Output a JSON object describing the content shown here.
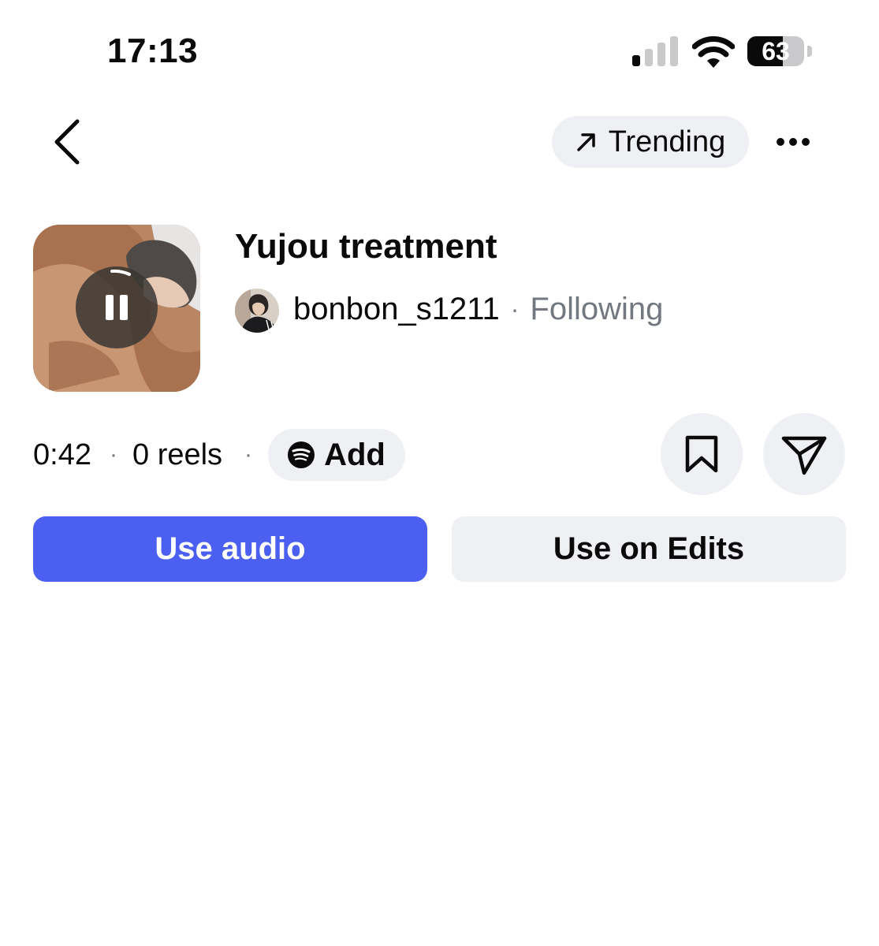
{
  "status_bar": {
    "time": "17:13",
    "battery_level": "63",
    "battery_fraction": 0.63,
    "icons": [
      "cellular-signal-icon",
      "wifi-icon",
      "battery-icon"
    ]
  },
  "nav": {
    "back_icon": "chevron-left-icon",
    "trending_label": "Trending",
    "trending_icon": "arrow-up-right-icon",
    "more_icon": "more-horizontal-icon"
  },
  "track": {
    "title": "Yujou treatment",
    "artist": "bonbon_s1211",
    "separator": "·",
    "follow_status": "Following",
    "playback_icon": "pause-icon"
  },
  "meta": {
    "duration": "0:42",
    "separator": "·",
    "reels_count": "0 reels",
    "add_label": "Add",
    "add_icon": "spotify-icon",
    "save_icon": "bookmark-icon",
    "share_icon": "paper-plane-icon"
  },
  "actions": {
    "use_audio_label": "Use audio",
    "use_edits_label": "Use on Edits"
  },
  "colors": {
    "accent": "#4b5ff0",
    "pill_bg": "#eff0f3",
    "muted_text": "#737780",
    "text": "#0a0a0a"
  }
}
